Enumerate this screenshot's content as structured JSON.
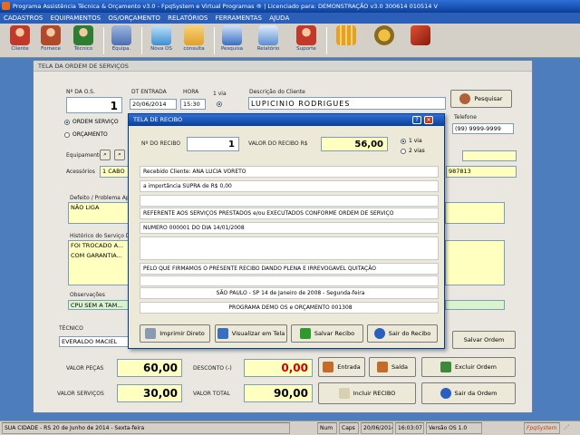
{
  "window": {
    "title": "Programa Assistência Técnica & Orçamento v3.0 - FpqSystem e Virtual Programas ® | Licenciado para: DEMONSTRAÇÃO v3.0 300614 010514 V"
  },
  "menu": [
    "CADASTROS",
    "EQUIPAMENTOS",
    "OS/ORÇAMENTO",
    "RELATÓRIOS",
    "FERRAMENTAS",
    "AJUDA"
  ],
  "toolbar": [
    {
      "label": "Cliente",
      "icon": "client-icon",
      "color": "#c0392b"
    },
    {
      "label": "Fornece",
      "icon": "supplier-icon",
      "color": "#b04a2a"
    },
    {
      "label": "Técnico",
      "icon": "technician-icon",
      "color": "#2e7d32"
    },
    {
      "label": "Equipa.",
      "icon": "equipment-icon",
      "color": "#4a6fb5"
    },
    {
      "label": "Nova OS",
      "icon": "new-order-icon",
      "color": "#3d8fd1"
    },
    {
      "label": "consulta",
      "icon": "search-folder-icon",
      "color": "#e0a12a"
    },
    {
      "label": "Pesquisa",
      "icon": "research-icon",
      "color": "#3a6fc0"
    },
    {
      "label": "Relatório",
      "icon": "report-icon",
      "color": "#5a8fd0"
    },
    {
      "label": "Suporte",
      "icon": "support-icon",
      "color": "#c0392b"
    },
    {
      "label": "",
      "icon": "calculator-icon",
      "color": "#e8a020"
    },
    {
      "label": "",
      "icon": "tools-icon",
      "color": "#d49a20"
    },
    {
      "label": "",
      "icon": "exit-icon",
      "color": "#c0392b"
    }
  ],
  "main": {
    "title": "TELA DA ORDEM DE SERVIÇOS",
    "os_label": "Nº DA O.S.",
    "os_value": "1",
    "date_label": "DT ENTRADA",
    "date_value": "20/06/2014",
    "hour_label": "HORA",
    "hour_value": "15:30",
    "via_label": "1 via",
    "client_label": "Descrição do Cliente",
    "client_value": "LUPICINIO RODRIGUES",
    "search_btn": "Pesquisar",
    "phone_label": "Telefone",
    "phone_value": "(99) 9999-9999",
    "radio_os": "ORDEM SERVIÇO",
    "radio_orc": "ORÇAMENTO",
    "equip_label": "Equipamento",
    "acess_label": "Acessórios",
    "acess_value": "1 CABO",
    "serial_value": "987813",
    "defeito_label": "Defeito / Problema Ap...",
    "defeito_value": "NÃO LIGA",
    "hist_label": "Histórico do Serviço D...",
    "hist_line1": "FOI TROCADO A...",
    "hist_line2": "COM GARANTIA...",
    "obs_label": "Observações",
    "obs_value": "CPU SEM A TAM...",
    "tec_label": "TÉCNICO",
    "tec_value": "EVERALDO MACIEL",
    "pecas_label": "VALOR PEÇAS",
    "pecas_value": "60,00",
    "serv_label": "VALOR SERVIÇOS",
    "serv_value": "30,00",
    "desc_label": "DESCONTO (-)",
    "desc_value": "0,00",
    "total_label": "VALOR TOTAL",
    "total_value": "90,00",
    "btn_entrada": "Entrada",
    "btn_saida": "Saída",
    "btn_incluir": "Incluir RECIBO",
    "btn_salvar": "Salvar Ordem",
    "btn_excluir": "Excluir Ordem",
    "btn_sair": "Sair da Ordem"
  },
  "dialog": {
    "title": "TELA DE RECIBO",
    "num_label": "Nº DO RECIBO",
    "num_value": "1",
    "valor_label": "VALOR DO RECIBO R$",
    "valor_value": "56,00",
    "via1": "1 via",
    "via2": "2 vias",
    "lines": [
      "Recebido Cliente: ANA LUCIA VORETO",
      "a importância SUPRA de R$          0,00",
      "",
      "REFERENTE AOS SERVIÇOS PRESTADOS e/ou EXECUTADOS CONFORME ORDEM DE SERVIÇO",
      "NUMERO 000001 DO DIA 14/01/2008",
      "",
      "PELO QUE FIRMAMOS O PRESENTE RECIBO DANDO PLENA E IRREVOGAVEL QUITAÇÃO",
      "",
      "SÃO PAULO - SP 14 de Janeiro de 2008 - Segunda-feira",
      "PROGRAMA DEMO OS e ORÇAMENTO 001308"
    ],
    "btn_print": "Imprimir Direto",
    "btn_view": "Visualizar em Tela",
    "btn_save": "Salvar Recibo",
    "btn_exit": "Sair do Recibo"
  },
  "status": {
    "city": "SUA CIDADE - RS 20 de Junho de 2014 - Sexta-feira",
    "num": "Num",
    "caps": "Caps",
    "date": "20/06/2014",
    "time": "16:03:07",
    "version": "Versão OS 1.0",
    "brand": "FpqSystem"
  }
}
